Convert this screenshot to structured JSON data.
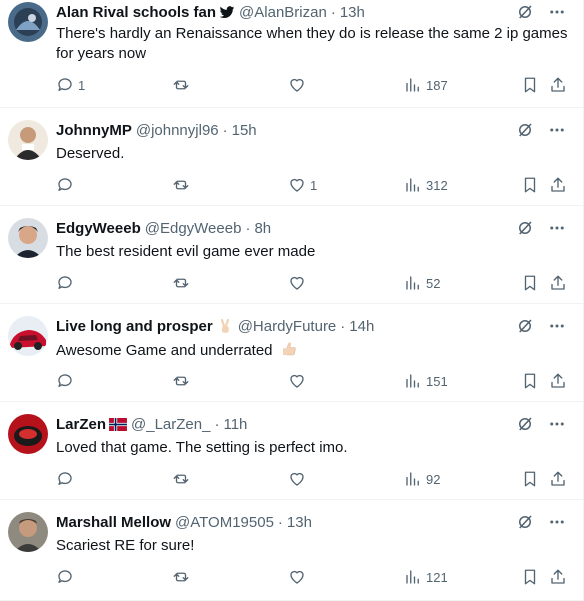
{
  "colors": {
    "text": "#0f1419",
    "muted": "#536471",
    "divider": "#eff3f4",
    "verified": "#1d9bf0"
  },
  "tweets": [
    {
      "name": "Alan Rival schools fan",
      "badge": "bird-icon",
      "handle": "@AlanBrizan",
      "dot": "·",
      "time": "13h",
      "text": "There's hardly an Renaissance when they do is release the same 2 ip games for years now",
      "replies": "1",
      "retweets": "",
      "likes": "",
      "views": "187"
    },
    {
      "name": "JohnnyMP",
      "handle": "@johnnyjl96",
      "dot": "·",
      "time": "15h",
      "text": "Deserved.",
      "replies": "",
      "retweets": "",
      "likes": "1",
      "views": "312"
    },
    {
      "name": "EdgyWeeeb",
      "handle": "@EdgyWeeeb",
      "dot": "·",
      "time": "8h",
      "text": "The best resident evil game ever made",
      "replies": "",
      "retweets": "",
      "likes": "",
      "views": "52"
    },
    {
      "name": "Live long and prosper",
      "badge": "victory-hand-emoji",
      "handle": "@HardyFuture",
      "dot": "·",
      "time": "14h",
      "text": "Awesome Game and underrated",
      "text_emoji": "thumbs-up-emoji",
      "replies": "",
      "retweets": "",
      "likes": "",
      "views": "151"
    },
    {
      "name": "LarZen",
      "badge": "norway-flag-icon",
      "handle": "@_LarZen_",
      "dot": "·",
      "time": "11h",
      "text": "Loved that game. The setting is perfect imo.",
      "replies": "",
      "retweets": "",
      "likes": "",
      "views": "92"
    },
    {
      "name": "Marshall Mellow",
      "handle": "@ATOM19505",
      "dot": "·",
      "time": "13h",
      "text": "Scariest RE for sure!",
      "replies": "",
      "retweets": "",
      "likes": "",
      "views": "121"
    }
  ]
}
